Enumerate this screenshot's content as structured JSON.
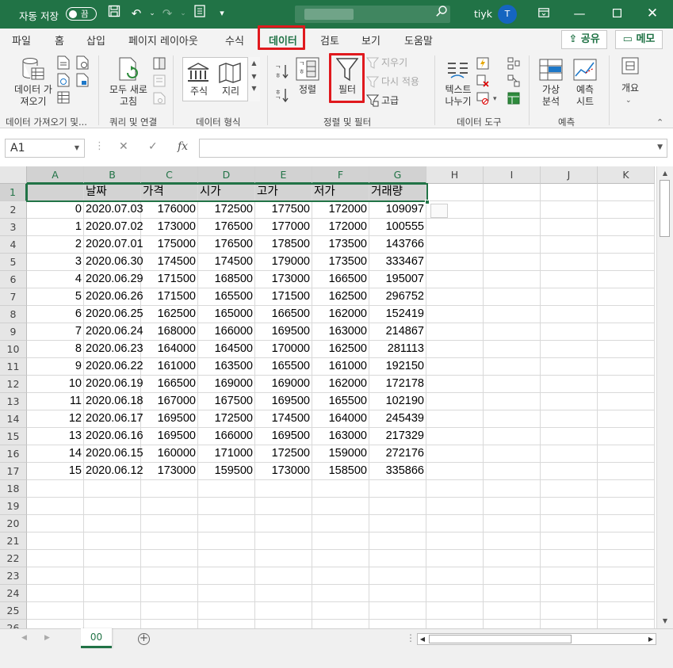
{
  "titlebar": {
    "autosave_label": "자동 저장",
    "autosave_state": "끔",
    "user_name": "tiyk",
    "avatar_initial": "T",
    "accent_color": "#217346"
  },
  "tabs": [
    "파일",
    "홈",
    "삽입",
    "페이지 레이아웃",
    "수식",
    "데이터",
    "검토",
    "보기",
    "도움말"
  ],
  "active_tab": "데이터",
  "share_label": "공유",
  "memo_label": "메모",
  "ribbon": {
    "get_data": "데이터 가\n져오기",
    "refresh_all": "모두 새로\n고침",
    "stocks": "주식",
    "geography": "지리",
    "sort": "정렬",
    "filter": "필터",
    "clear": "지우기",
    "reapply": "다시 적용",
    "advanced": "고급",
    "text_to_columns": "텍스트\n나누기",
    "what_if": "가상\n분석",
    "forecast_sheet": "예측\n시트",
    "outline": "개요",
    "groups": {
      "get_transform": "데이터 가져오기 및...",
      "queries": "쿼리 및 연결",
      "data_types": "데이터 형식",
      "sort_filter": "정렬 및 필터",
      "data_tools": "데이터 도구",
      "forecast": "예측"
    }
  },
  "formula_bar": {
    "name_box": "A1",
    "formula": ""
  },
  "grid": {
    "columns": [
      "A",
      "B",
      "C",
      "D",
      "E",
      "F",
      "G",
      "H",
      "I",
      "J",
      "K"
    ],
    "header_row": [
      "",
      "날짜",
      "가격",
      "시가",
      "고가",
      "저가",
      "거래량"
    ],
    "rows": [
      [
        "0",
        "2020.07.03",
        "176000",
        "172500",
        "177500",
        "172000",
        "109097"
      ],
      [
        "1",
        "2020.07.02",
        "173000",
        "176500",
        "177000",
        "172000",
        "100555"
      ],
      [
        "2",
        "2020.07.01",
        "175000",
        "176500",
        "178500",
        "173500",
        "143766"
      ],
      [
        "3",
        "2020.06.30",
        "174500",
        "174500",
        "179000",
        "173500",
        "333467"
      ],
      [
        "4",
        "2020.06.29",
        "171500",
        "168500",
        "173000",
        "166500",
        "195007"
      ],
      [
        "5",
        "2020.06.26",
        "171500",
        "165500",
        "171500",
        "162500",
        "296752"
      ],
      [
        "6",
        "2020.06.25",
        "162500",
        "165000",
        "166500",
        "162000",
        "152419"
      ],
      [
        "7",
        "2020.06.24",
        "168000",
        "166000",
        "169500",
        "163000",
        "214867"
      ],
      [
        "8",
        "2020.06.23",
        "164000",
        "164500",
        "170000",
        "162500",
        "281113"
      ],
      [
        "9",
        "2020.06.22",
        "161000",
        "163500",
        "165500",
        "161000",
        "192150"
      ],
      [
        "10",
        "2020.06.19",
        "166500",
        "169000",
        "169000",
        "162000",
        "172178"
      ],
      [
        "11",
        "2020.06.18",
        "167000",
        "167500",
        "169500",
        "165500",
        "102190"
      ],
      [
        "12",
        "2020.06.17",
        "169500",
        "172500",
        "174500",
        "164000",
        "245439"
      ],
      [
        "13",
        "2020.06.16",
        "169500",
        "166000",
        "169500",
        "163000",
        "217329"
      ],
      [
        "14",
        "2020.06.15",
        "160000",
        "171000",
        "172500",
        "159000",
        "272176"
      ],
      [
        "15",
        "2020.06.12",
        "173000",
        "159500",
        "173000",
        "158500",
        "335866"
      ]
    ],
    "row_count": 26
  },
  "sheet_tab": "00"
}
